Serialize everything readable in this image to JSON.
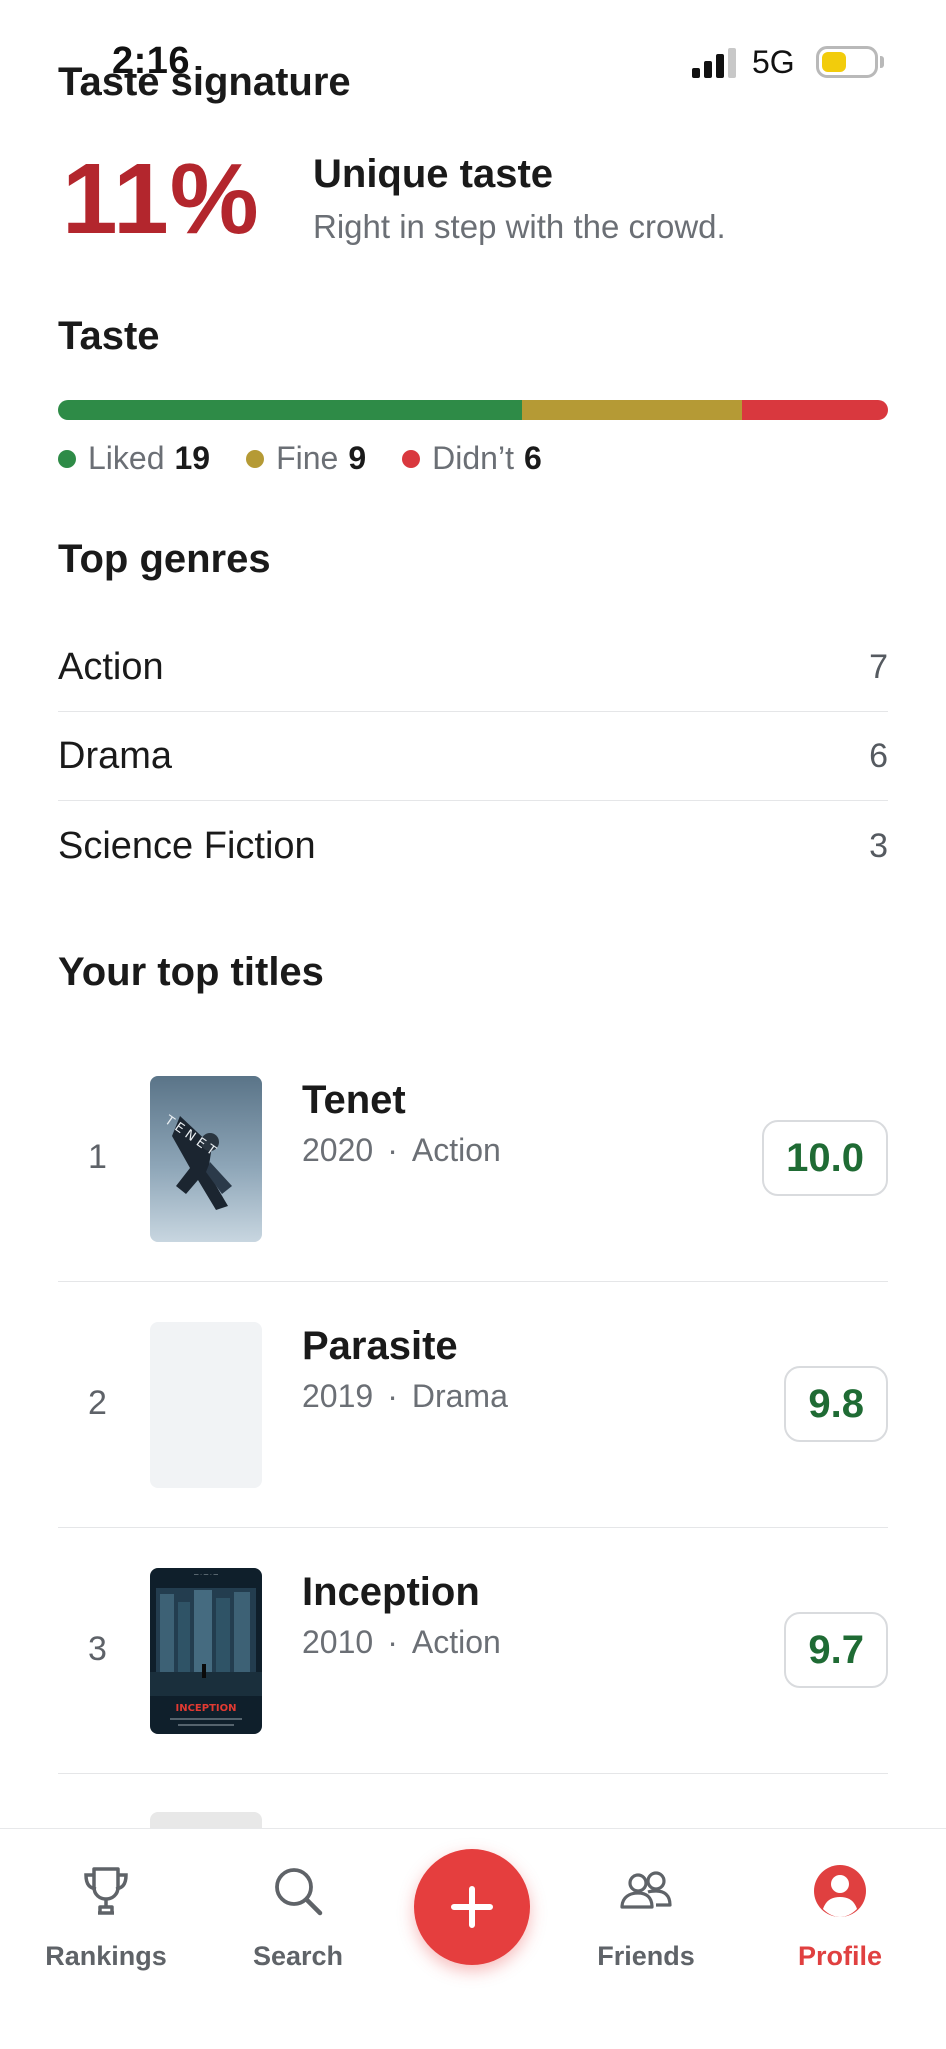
{
  "status_bar": {
    "time": "2:16",
    "network": "5G",
    "battery_level": 0.42,
    "signal_bars_active": 3
  },
  "taste_signature": {
    "heading": "Taste signature",
    "percent": "11%",
    "label": "Unique taste",
    "description": "Right in step with the crowd."
  },
  "taste": {
    "heading": "Taste",
    "segments": [
      {
        "key": "liked",
        "label": "Liked",
        "count": "19",
        "value": 19,
        "color": "#2e8b47"
      },
      {
        "key": "fine",
        "label": "Fine",
        "count": "9",
        "value": 9,
        "color": "#b59a35"
      },
      {
        "key": "didnt",
        "label": "Didn’t",
        "count": "6",
        "value": 6,
        "color": "#d9383e"
      }
    ]
  },
  "top_genres": {
    "heading": "Top genres",
    "items": [
      {
        "name": "Action",
        "count": "7"
      },
      {
        "name": "Drama",
        "count": "6"
      },
      {
        "name": "Science Fiction",
        "count": "3"
      }
    ]
  },
  "top_titles": {
    "heading": "Your top titles",
    "items": [
      {
        "rank": "1",
        "title": "Tenet",
        "year": "2020",
        "separator": "·",
        "genre": "Action",
        "score": "10.0",
        "poster": "tenet-poster"
      },
      {
        "rank": "2",
        "title": "Parasite",
        "year": "2019",
        "separator": "·",
        "genre": "Drama",
        "score": "9.8",
        "poster": "placeholder"
      },
      {
        "rank": "3",
        "title": "Inception",
        "year": "2010",
        "separator": "·",
        "genre": "Action",
        "score": "9.7",
        "poster": "inception-poster",
        "poster_text": "INCEPTION"
      }
    ]
  },
  "bottom_nav": {
    "items": [
      {
        "label": "Rankings",
        "icon": "trophy-icon"
      },
      {
        "label": "Search",
        "icon": "search-icon"
      },
      {
        "label": "Friends",
        "icon": "friends-icon"
      },
      {
        "label": "Profile",
        "icon": "profile-icon",
        "active": true
      }
    ],
    "add_icon": "plus-icon",
    "accent": "#e53e3e"
  }
}
